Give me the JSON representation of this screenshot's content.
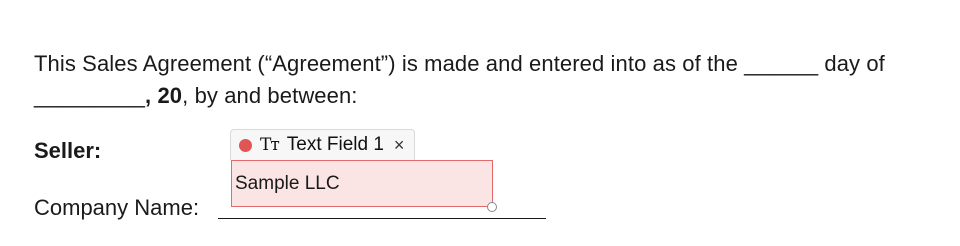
{
  "agreement": {
    "line1": "This Sales Agreement (“Agreement”) is made and entered into as of the ______ day of",
    "blank2": "_________",
    "year_bold": ", 20",
    "line2_rest": ", by and between:"
  },
  "seller_label": "Seller:",
  "company_label": "Company Name:",
  "field": {
    "tag_label": "Text Field 1",
    "icon_glyph": "Tт",
    "close_glyph": "×",
    "value": "Sample LLC",
    "status_color": "#e05555"
  }
}
